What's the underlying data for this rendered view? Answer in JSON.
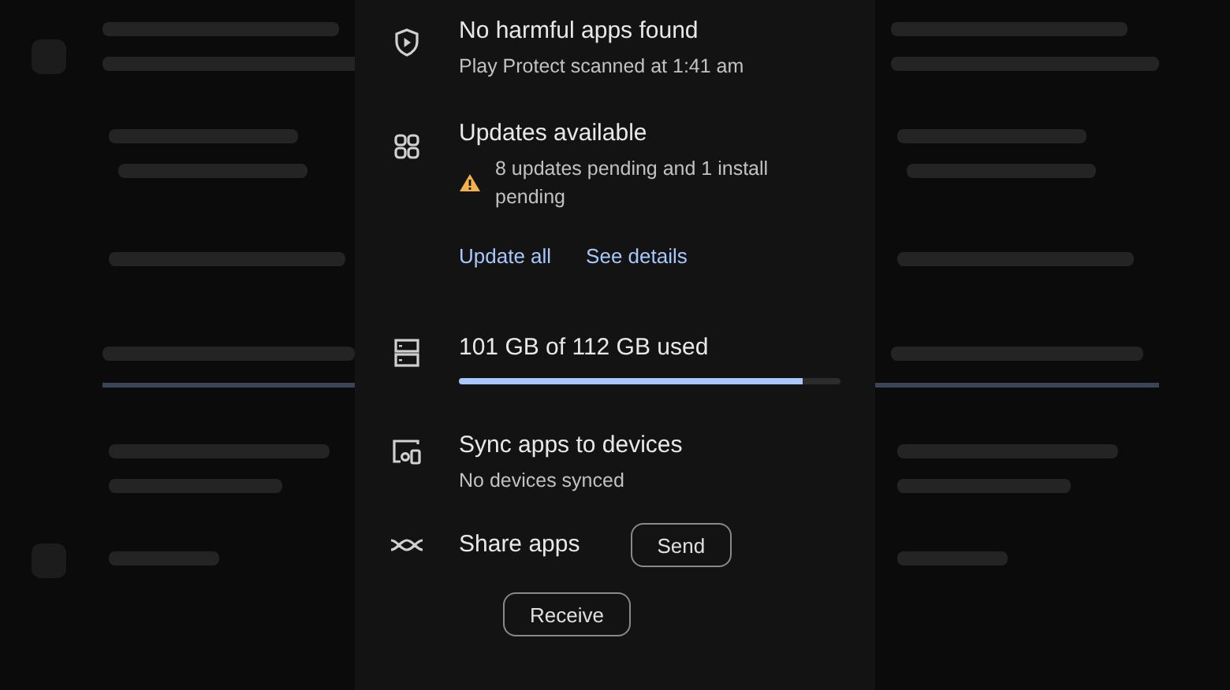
{
  "protection": {
    "title": "No harmful apps found",
    "subtitle": "Play Protect scanned at 1:41 am"
  },
  "updates": {
    "title": "Updates available",
    "warning": "8 updates pending and 1 install pending",
    "actions": [
      "Update all",
      "See details"
    ]
  },
  "storage": {
    "title": "101 GB of 112 GB used",
    "level": 0.9
  },
  "sync": {
    "title": "Sync apps to devices",
    "subtitle": "No devices synced"
  },
  "share": {
    "title": "Share apps",
    "buttons": [
      "Send",
      "Receive"
    ]
  }
}
